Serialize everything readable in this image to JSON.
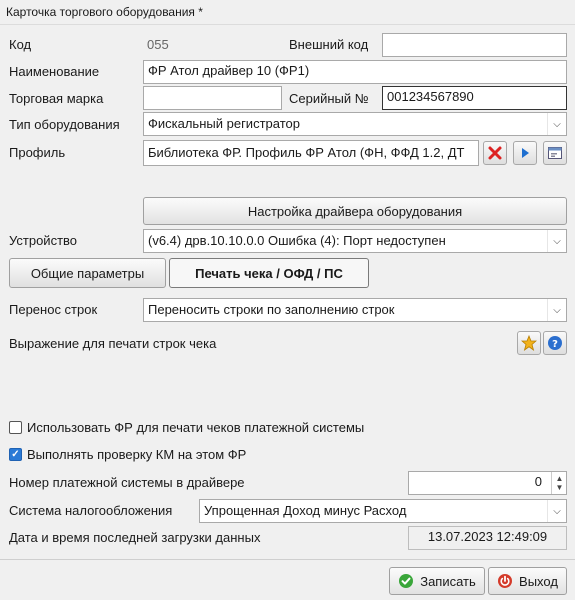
{
  "window": {
    "title": "Карточка торгового оборудования *"
  },
  "fields": {
    "code_label": "Код",
    "code_value": "055",
    "external_code_label": "Внешний код",
    "external_code_value": "",
    "name_label": "Наименование",
    "name_value": "ФР Атол драйвер 10 (ФР1)",
    "trademark_label": "Торговая марка",
    "trademark_value": "",
    "serial_label": "Серийный №",
    "serial_value": "001234567890",
    "equipment_type_label": "Тип оборудования",
    "equipment_type_value": "Фискальный регистратор",
    "profile_label": "Профиль",
    "profile_value": "Библиотека ФР. Профиль ФР Атол (ФН, ФФД 1.2, ДТ",
    "driver_settings_button": "Настройка драйвера оборудования",
    "device_label": "Устройство",
    "device_value": "(v6.4) дрв.10.10.0.0 Ошибка (4): Порт недоступен"
  },
  "tabs": [
    {
      "label": "Общие параметры",
      "active": false
    },
    {
      "label": "Печать чека / ОФД / ПС",
      "active": true
    }
  ],
  "print_section": {
    "line_wrap_label": "Перенос строк",
    "line_wrap_value": "Переносить строки по заполнению строк",
    "expression_label": "Выражение для печати строк чека",
    "use_fr_label": "Использовать ФР для печати чеков платежной системы",
    "use_fr_checked": false,
    "check_km_label": "Выполнять проверку КМ на этом ФР",
    "check_km_checked": true,
    "payment_system_label": "Номер платежной системы в драйвере",
    "payment_system_value": "0",
    "tax_system_label": "Система налогообложения",
    "tax_system_value": "Упрощенная Доход минус Расход",
    "last_load_label": "Дата и время последней загрузки данных",
    "last_load_value": "13.07.2023 12:49:09"
  },
  "footer": {
    "save_label": "Записать",
    "exit_label": "Выход"
  },
  "colors": {
    "save_icon": "#3aa63a",
    "exit_icon": "#d43a2a",
    "check_accent": "#2a7ad6"
  }
}
